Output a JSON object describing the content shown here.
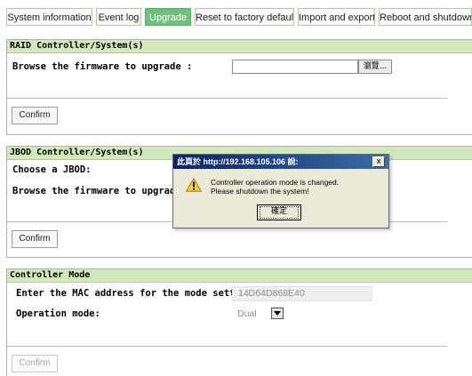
{
  "tabs": [
    {
      "label": "System information",
      "active": false
    },
    {
      "label": "Event log",
      "active": false
    },
    {
      "label": "Upgrade",
      "active": true
    },
    {
      "label": "Reset to factory default",
      "active": false
    },
    {
      "label": "Import and export",
      "active": false
    },
    {
      "label": "Reboot and shutdown",
      "active": false
    }
  ],
  "raid": {
    "title": "RAID Controller/System(s)",
    "browse_label": "Browse the firmware to upgrade :",
    "browse_button": "瀏覽...",
    "confirm": "Confirm"
  },
  "jbod": {
    "title": "JBOD Controller/System(s)",
    "choose_label": "Choose a JBOD:",
    "browse_label": "Browse the firmware to upgrade:",
    "confirm": "Confirm"
  },
  "controller_mode": {
    "title": "Controller Mode",
    "mac_label": "Enter the MAC address for the mode setting:",
    "mac_value": "14D64D868E40",
    "op_label": "Operation mode:",
    "op_value": "Dual",
    "confirm": "Confirm"
  },
  "dialog": {
    "title": "此頁於 http://192.168.105.106 說:",
    "close": "x",
    "line1": "Controller operation mode is changed.",
    "line2": "Please shutdown the system!",
    "ok": "確定",
    "icon": "warning-icon"
  },
  "colors": {
    "active_tab": "#6fc07e",
    "section_header": "#d3e7bd",
    "dialog_title": "#0a246a"
  }
}
